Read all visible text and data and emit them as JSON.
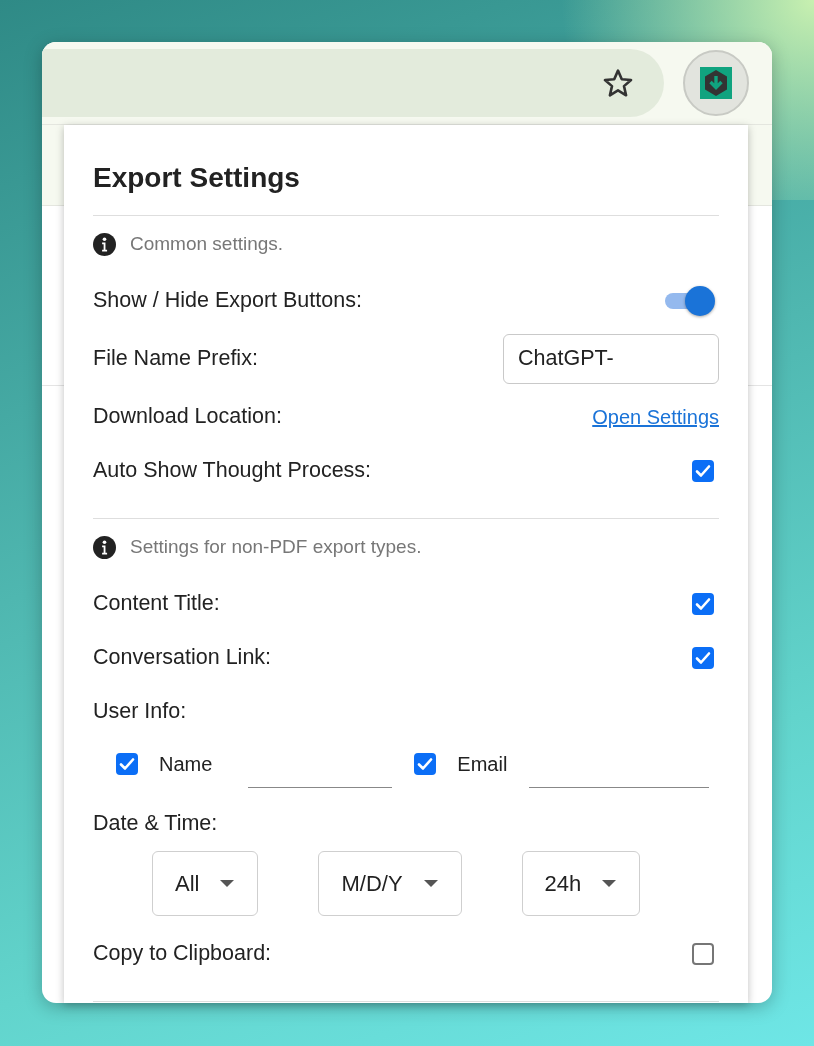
{
  "title": "Export Settings",
  "sections": [
    {
      "note": "Common settings.",
      "rows": [
        {
          "kind": "toggle",
          "label": "Show / Hide Export Buttons:",
          "on": true
        },
        {
          "kind": "text",
          "label": "File Name Prefix:",
          "value": "ChatGPT-"
        },
        {
          "kind": "link",
          "label": "Download Location:",
          "link": "Open Settings"
        },
        {
          "kind": "checkbox",
          "label": "Auto Show Thought Process:",
          "checked": true
        }
      ]
    },
    {
      "note": "Settings for non-PDF export types.",
      "rows": [
        {
          "kind": "checkbox",
          "label": "Content Title:",
          "checked": true
        },
        {
          "kind": "checkbox",
          "label": "Conversation Link:",
          "checked": true
        },
        {
          "kind": "user_info",
          "label": "User Info:",
          "fields": [
            {
              "label": "Name",
              "checked": true
            },
            {
              "label": "Email",
              "checked": true
            }
          ]
        },
        {
          "kind": "selects",
          "label": "Date & Time:",
          "options": [
            "All",
            "M/D/Y",
            "24h"
          ]
        },
        {
          "kind": "checkbox",
          "label": "Copy to Clipboard:",
          "checked": false
        }
      ]
    }
  ]
}
